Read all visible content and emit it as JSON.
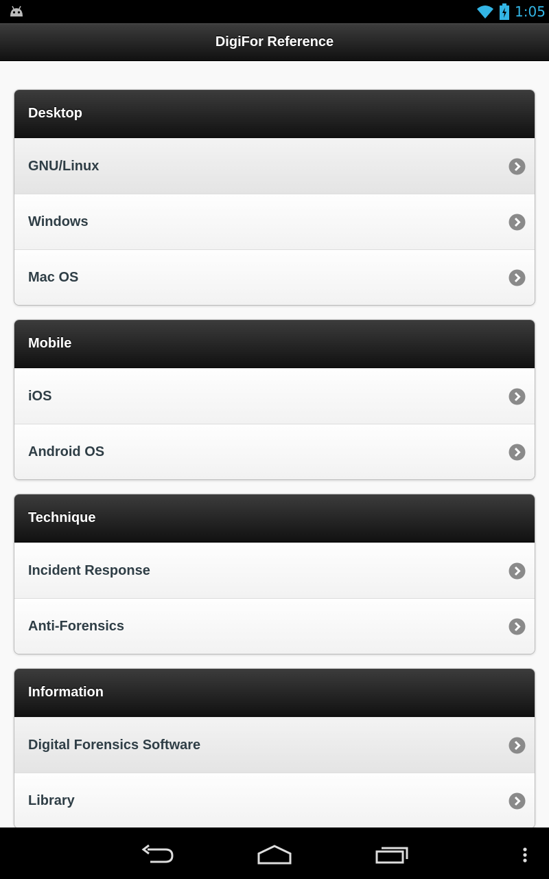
{
  "status_bar": {
    "time": "1:05",
    "icons": [
      "android-icon",
      "wifi-icon",
      "battery-charging-icon"
    ],
    "accent_color": "#33b5e5"
  },
  "header": {
    "title": "DigiFor Reference"
  },
  "groups": [
    {
      "title": "Desktop",
      "items": [
        "GNU/Linux",
        "Windows",
        "Mac OS"
      ]
    },
    {
      "title": "Mobile",
      "items": [
        "iOS",
        "Android OS"
      ]
    },
    {
      "title": "Technique",
      "items": [
        "Incident Response",
        "Anti-Forensics"
      ]
    },
    {
      "title": "Information",
      "items": [
        "Digital Forensics Software",
        "Library"
      ]
    }
  ],
  "nav_bar": {
    "icons": [
      "back-icon",
      "home-icon",
      "recent-apps-icon",
      "menu-icon"
    ]
  }
}
